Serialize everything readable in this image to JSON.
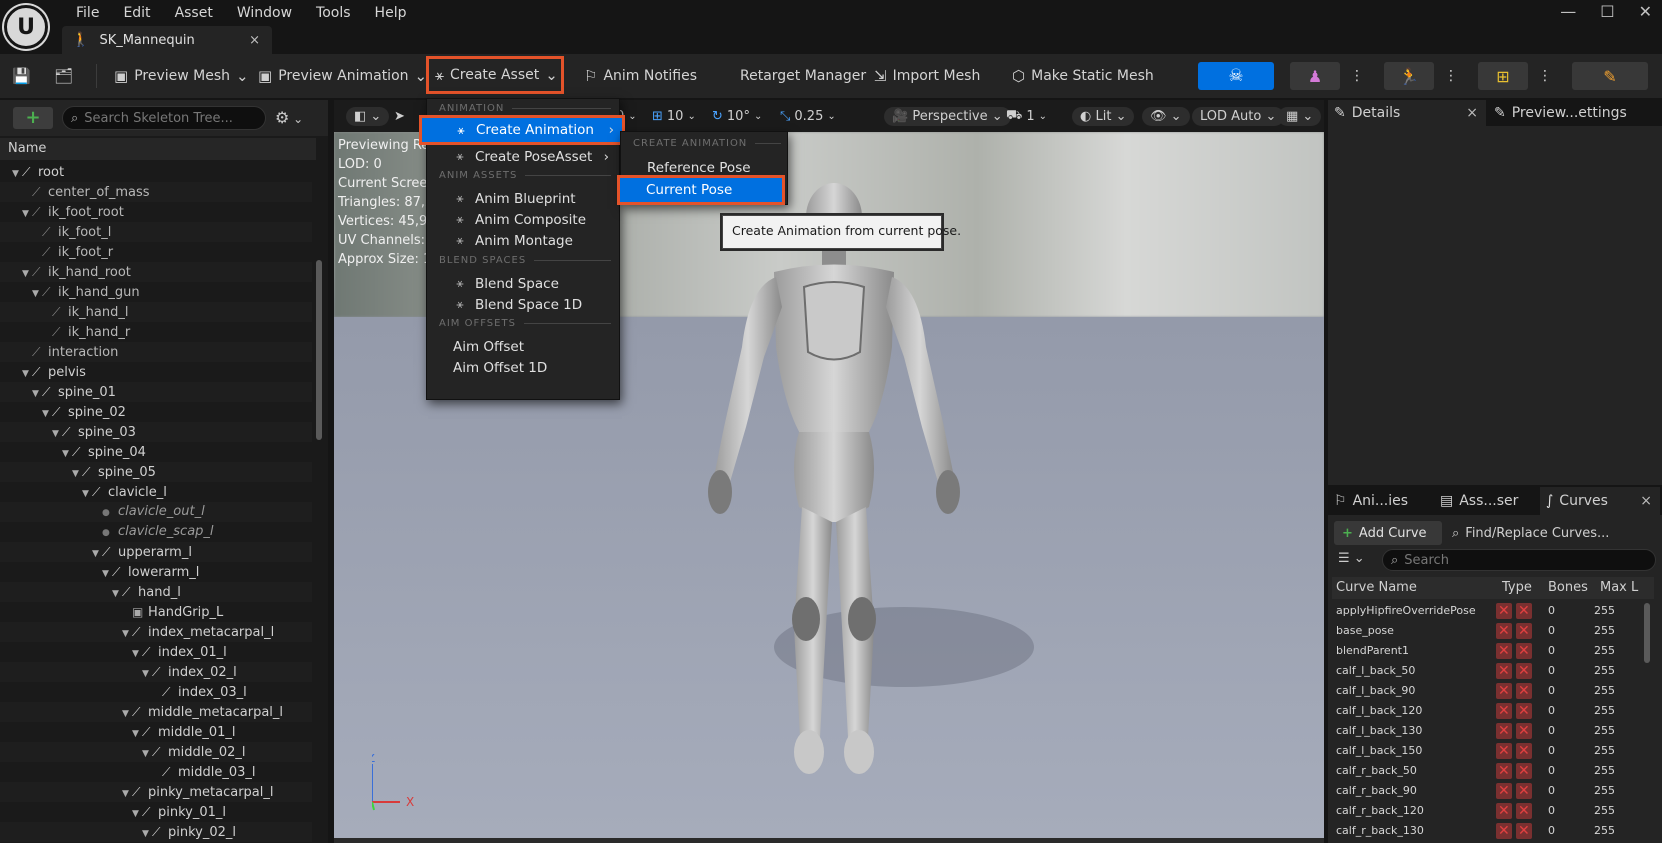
{
  "app": {
    "logo": "unreal-logo-icon"
  },
  "menubar": {
    "items": [
      "File",
      "Edit",
      "Asset",
      "Window",
      "Tools",
      "Help"
    ]
  },
  "window_controls": {
    "minimize": "—",
    "maximize": "☐",
    "close": "✕"
  },
  "document_tab": {
    "label": "SK_Mannequin",
    "close": "×"
  },
  "toolbar": {
    "preview_mesh": "Preview Mesh",
    "preview_animation": "Preview Animation",
    "create_asset": "Create Asset",
    "anim_notifies": "Anim Notifies",
    "retarget_manager": "Retarget Manager",
    "import_mesh": "Import Mesh",
    "make_static_mesh": "Make Static Mesh"
  },
  "skeleton_tree": {
    "search_placeholder": "Search Skeleton Tree...",
    "column_name": "Name",
    "rows": [
      {
        "label": "root",
        "depth": 0,
        "arrow": "▼",
        "kind": "bone"
      },
      {
        "label": "center_of_mass",
        "depth": 1,
        "arrow": "",
        "kind": "nondef"
      },
      {
        "label": "ik_foot_root",
        "depth": 1,
        "arrow": "▼",
        "kind": "nondef"
      },
      {
        "label": "ik_foot_l",
        "depth": 2,
        "arrow": "",
        "kind": "nondef"
      },
      {
        "label": "ik_foot_r",
        "depth": 2,
        "arrow": "",
        "kind": "nondef"
      },
      {
        "label": "ik_hand_root",
        "depth": 1,
        "arrow": "▼",
        "kind": "nondef"
      },
      {
        "label": "ik_hand_gun",
        "depth": 2,
        "arrow": "▼",
        "kind": "nondef"
      },
      {
        "label": "ik_hand_l",
        "depth": 3,
        "arrow": "",
        "kind": "nondef"
      },
      {
        "label": "ik_hand_r",
        "depth": 3,
        "arrow": "",
        "kind": "nondef"
      },
      {
        "label": "interaction",
        "depth": 1,
        "arrow": "",
        "kind": "nondef"
      },
      {
        "label": "pelvis",
        "depth": 1,
        "arrow": "▼",
        "kind": "bone"
      },
      {
        "label": "spine_01",
        "depth": 2,
        "arrow": "▼",
        "kind": "bone"
      },
      {
        "label": "spine_02",
        "depth": 3,
        "arrow": "▼",
        "kind": "bone"
      },
      {
        "label": "spine_03",
        "depth": 4,
        "arrow": "▼",
        "kind": "bone"
      },
      {
        "label": "spine_04",
        "depth": 5,
        "arrow": "▼",
        "kind": "bone"
      },
      {
        "label": "spine_05",
        "depth": 6,
        "arrow": "▼",
        "kind": "bone"
      },
      {
        "label": "clavicle_l",
        "depth": 7,
        "arrow": "▼",
        "kind": "bone"
      },
      {
        "label": "clavicle_out_l",
        "depth": 8,
        "arrow": "",
        "kind": "socket"
      },
      {
        "label": "clavicle_scap_l",
        "depth": 8,
        "arrow": "",
        "kind": "socket"
      },
      {
        "label": "upperarm_l",
        "depth": 8,
        "arrow": "▼",
        "kind": "bone"
      },
      {
        "label": "lowerarm_l",
        "depth": 9,
        "arrow": "▼",
        "kind": "bone"
      },
      {
        "label": "hand_l",
        "depth": 10,
        "arrow": "▼",
        "kind": "bone"
      },
      {
        "label": "HandGrip_L",
        "depth": 11,
        "arrow": "",
        "kind": "grip"
      },
      {
        "label": "index_metacarpal_l",
        "depth": 11,
        "arrow": "▼",
        "kind": "bone"
      },
      {
        "label": "index_01_l",
        "depth": 12,
        "arrow": "▼",
        "kind": "bone"
      },
      {
        "label": "index_02_l",
        "depth": 13,
        "arrow": "▼",
        "kind": "bone"
      },
      {
        "label": "index_03_l",
        "depth": 14,
        "arrow": "",
        "kind": "bone"
      },
      {
        "label": "middle_metacarpal_l",
        "depth": 11,
        "arrow": "▼",
        "kind": "bone"
      },
      {
        "label": "middle_01_l",
        "depth": 12,
        "arrow": "▼",
        "kind": "bone"
      },
      {
        "label": "middle_02_l",
        "depth": 13,
        "arrow": "▼",
        "kind": "bone"
      },
      {
        "label": "middle_03_l",
        "depth": 14,
        "arrow": "",
        "kind": "bone"
      },
      {
        "label": "pinky_metacarpal_l",
        "depth": 11,
        "arrow": "▼",
        "kind": "bone"
      },
      {
        "label": "pinky_01_l",
        "depth": 12,
        "arrow": "▼",
        "kind": "bone"
      },
      {
        "label": "pinky_02_l",
        "depth": 13,
        "arrow": "▼",
        "kind": "bone"
      }
    ]
  },
  "viewport": {
    "toolbar": {
      "grid_snap": "10",
      "rot_snap": "10°",
      "scale_snap": "0.25",
      "perspective": "Perspective",
      "speed": "1",
      "lit": "Lit",
      "lod": "LOD Auto",
      "partial_zero": "0"
    },
    "stats": [
      "Previewing Re",
      "LOD: 0",
      "Current Scree",
      "Triangles: 87,2",
      "Vertices: 45,9",
      "UV Channels:",
      "Approx Size: 1"
    ],
    "gizmo": {
      "z": "Z",
      "x": "X"
    }
  },
  "create_asset_menu": {
    "sections": {
      "animation": "ANIMATION",
      "anim_assets": "ANIM ASSETS",
      "blend_spaces": "BLEND SPACES",
      "aim_offsets": "AIM OFFSETS"
    },
    "items": {
      "create_animation": "Create Animation",
      "create_pose_asset": "Create PoseAsset",
      "anim_blueprint": "Anim Blueprint",
      "anim_composite": "Anim Composite",
      "anim_montage": "Anim Montage",
      "blend_space": "Blend Space",
      "blend_space_1d": "Blend Space 1D",
      "aim_offset": "Aim Offset",
      "aim_offset_1d": "Aim Offset 1D"
    }
  },
  "create_animation_submenu": {
    "section": "CREATE ANIMATION",
    "reference_pose": "Reference Pose",
    "current_pose": "Current Pose"
  },
  "tooltip": {
    "text": "Create Animation from current pose."
  },
  "right_top": {
    "tab_details": "Details",
    "tab_preview": "Preview...ettings",
    "close": "×"
  },
  "right_bottom": {
    "tab_anim": "Ani...ies",
    "tab_asset": "Ass...ser",
    "tab_curves": "Curves",
    "close": "×",
    "add_curve": "Add Curve",
    "find_replace": "Find/Replace Curves...",
    "search_placeholder": "Search",
    "columns": {
      "name": "Curve Name",
      "type": "Type",
      "bones": "Bones",
      "max": "Max L"
    },
    "rows": [
      {
        "name": "applyHipfireOverridePose",
        "bones": "0",
        "max": "255"
      },
      {
        "name": "base_pose",
        "bones": "0",
        "max": "255"
      },
      {
        "name": "blendParent1",
        "bones": "0",
        "max": "255"
      },
      {
        "name": "calf_l_back_50",
        "bones": "0",
        "max": "255"
      },
      {
        "name": "calf_l_back_90",
        "bones": "0",
        "max": "255"
      },
      {
        "name": "calf_l_back_120",
        "bones": "0",
        "max": "255"
      },
      {
        "name": "calf_l_back_130",
        "bones": "0",
        "max": "255"
      },
      {
        "name": "calf_l_back_150",
        "bones": "0",
        "max": "255"
      },
      {
        "name": "calf_r_back_50",
        "bones": "0",
        "max": "255"
      },
      {
        "name": "calf_r_back_90",
        "bones": "0",
        "max": "255"
      },
      {
        "name": "calf_r_back_120",
        "bones": "0",
        "max": "255"
      },
      {
        "name": "calf_r_back_130",
        "bones": "0",
        "max": "255"
      }
    ]
  },
  "colors": {
    "accent_blue": "#0070e0",
    "highlight_orange": "#e4532a",
    "panel_bg": "#242424",
    "dark_bg": "#151515"
  }
}
